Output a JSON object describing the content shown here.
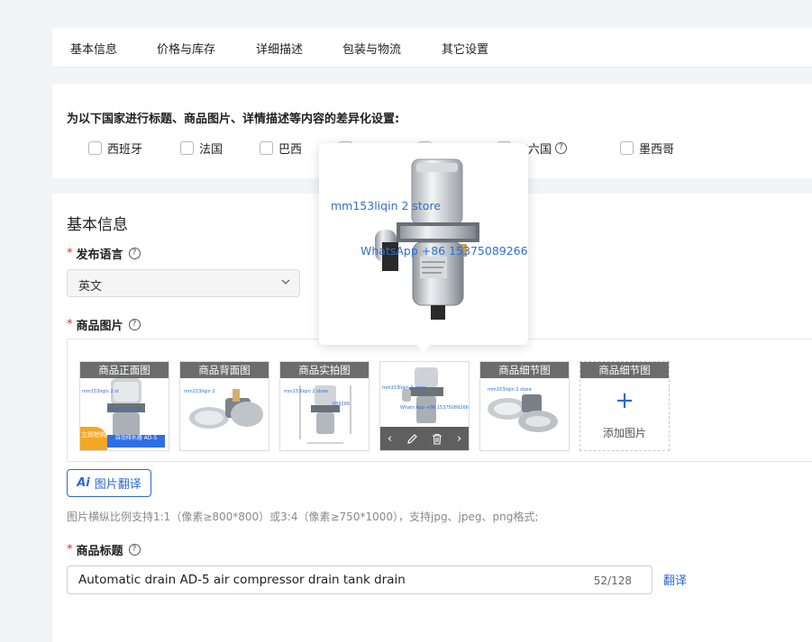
{
  "tabs": [
    "基本信息",
    "价格与库存",
    "详细描述",
    "包装与物流",
    "其它设置"
  ],
  "diff_section": {
    "title": "为以下国家进行标题、商品图片、详情描述等内容的差异化设置:",
    "countries": [
      "西班牙",
      "法国",
      "巴西",
      "",
      "",
      "东六国",
      "墨西哥"
    ]
  },
  "basic": {
    "section_title": "基本信息",
    "language_label": "发布语言",
    "language_value": "英文",
    "images_label": "商品图片",
    "thumbs": [
      {
        "caption": "商品正面图",
        "wm1": "mm153liqin 2 st",
        "wm2": "What 6089266"
      },
      {
        "caption": "商品背面图",
        "wm1": "mm153liqin 2",
        "wm2": ""
      },
      {
        "caption": "商品实拍图",
        "wm1": "mm153liqin 2 store",
        "wm2": "089266"
      },
      {
        "caption": "",
        "wm1": "mm153liqin 2 store",
        "wm2": "Whats App +86 15375089266"
      },
      {
        "caption": "商品细节图",
        "wm1": "mm153liqin 2 store",
        "wm2": ""
      },
      {
        "caption": "商品细节图"
      }
    ],
    "promo_tag": "立即抢购",
    "promo_text": "自动排水器 AD-5",
    "add_image": "添加图片",
    "translate_btn_ai": "Ai",
    "translate_btn": "图片翻译",
    "hint": "图片横纵比例支持1:1（像素≥800*800）或3:4（像素≥750*1000），支持jpg、jpeg、png格式;",
    "title_label": "商品标题",
    "title_value": "Automatic drain AD-5 air compressor drain tank drain",
    "title_count": "52/128",
    "translate_link": "翻译"
  },
  "popover": {
    "watermark1": "mm153liqin 2 store",
    "watermark2": "WhatsApp +86 15375089266"
  },
  "colors": {
    "accent": "#2b66d9",
    "required": "#e0301e",
    "caption_bg": "#6c6c6c"
  }
}
